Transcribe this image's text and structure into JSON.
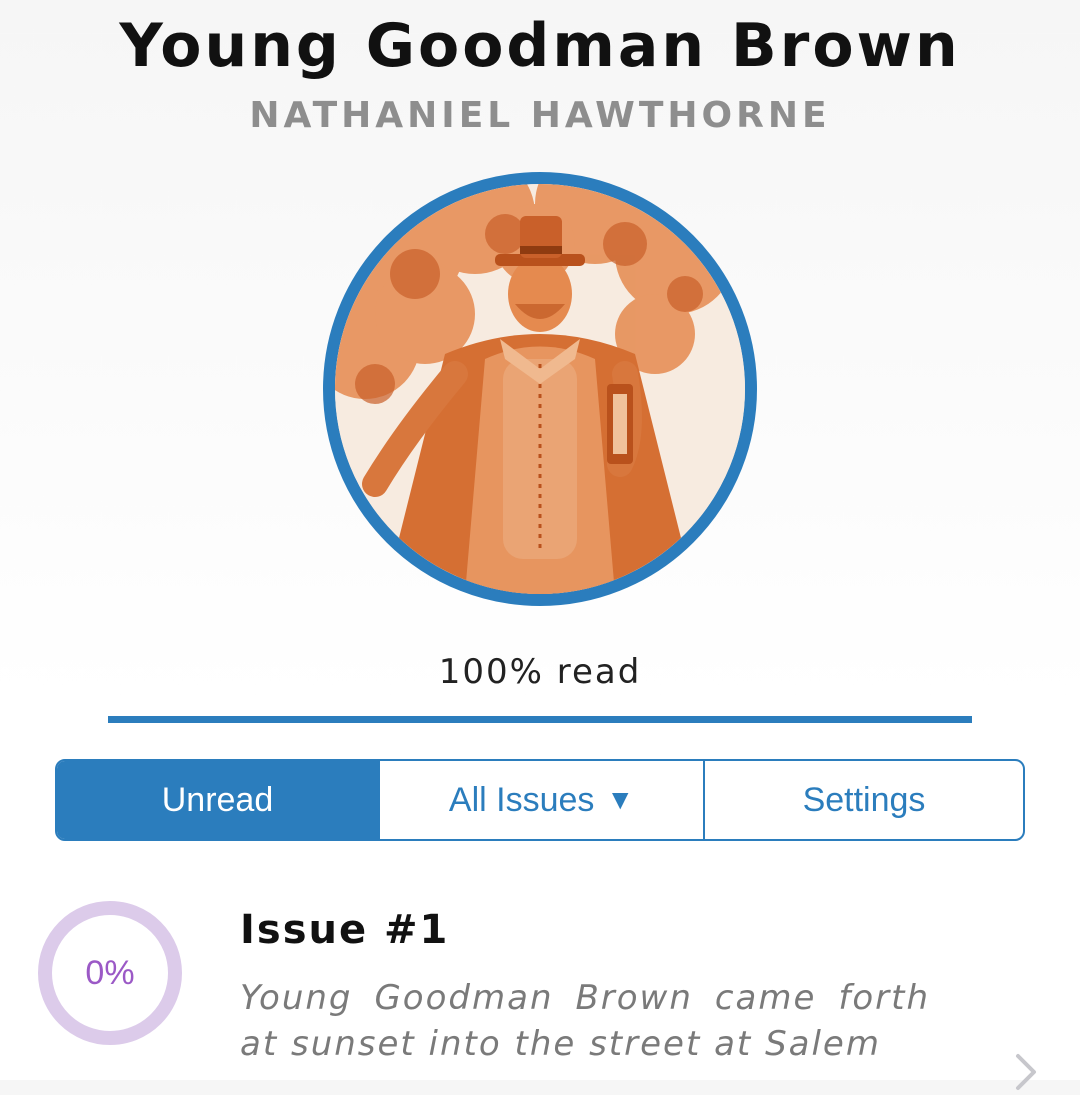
{
  "book": {
    "title": "Young Goodman Brown",
    "author": "NATHANIEL HAWTHORNE",
    "progress_label": "100% read",
    "progress_fraction": 1.0
  },
  "tabs": {
    "unread": "Unread",
    "all_issues": "All Issues",
    "all_issues_caret": "▼",
    "settings": "Settings"
  },
  "issue": {
    "percent_label": "0%",
    "progress_fraction": 0.0,
    "title": "Issue #1",
    "excerpt": "Young Goodman Brown came forth at sunset into the street at Salem"
  },
  "icons": {
    "disclosure": "chevron-right-icon"
  },
  "colors": {
    "accent": "#2b7dbd",
    "cover_tint": "#e07a3a",
    "issue_ring": "#dccbea",
    "issue_percent": "#9b59c6"
  }
}
